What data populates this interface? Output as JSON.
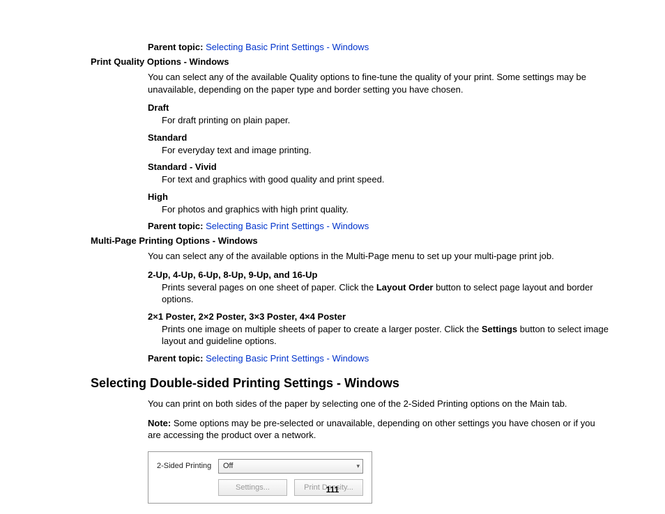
{
  "pt_label": "Parent topic:",
  "pt_link": "Selecting Basic Print Settings - Windows",
  "sec1": {
    "title": "Print Quality Options - Windows",
    "intro": "You can select any of the available Quality options to fine-tune the quality of your print. Some settings may be unavailable, depending on the paper type and border setting you have chosen.",
    "items": [
      {
        "term": "Draft",
        "desc": "For draft printing on plain paper."
      },
      {
        "term": "Standard",
        "desc": "For everyday text and image printing."
      },
      {
        "term": "Standard - Vivid",
        "desc": "For text and graphics with good quality and print speed."
      },
      {
        "term": "High",
        "desc": "For photos and graphics with high print quality."
      }
    ]
  },
  "sec2": {
    "title": "Multi-Page Printing Options - Windows",
    "intro": "You can select any of the available options in the Multi-Page menu to set up your multi-page print job.",
    "item1": {
      "term": "2-Up, 4-Up, 6-Up, 8-Up, 9-Up, and 16-Up",
      "d1": "Prints several pages on one sheet of paper. Click the ",
      "bold1": "Layout Order",
      "d2": " button to select page layout and border options."
    },
    "item2": {
      "term": "2×1 Poster, 2×2 Poster, 3×3 Poster, 4×4 Poster",
      "d1": "Prints one image on multiple sheets of paper to create a larger poster. Click the ",
      "bold1": "Settings",
      "d2": " button to select image layout and guideline options."
    }
  },
  "sec3": {
    "title": "Selecting Double-sided Printing Settings - Windows",
    "intro": "You can print on both sides of the paper by selecting one of the 2-Sided Printing options on the Main tab.",
    "note_label": "Note:",
    "note_text": " Some options may be pre-selected or unavailable, depending on other settings you have chosen or if you are accessing the product over a network."
  },
  "figure": {
    "label": "2-Sided Printing",
    "select_value": "Off",
    "btn1": "Settings...",
    "btn2": "Print Density..."
  },
  "page_number": "111"
}
